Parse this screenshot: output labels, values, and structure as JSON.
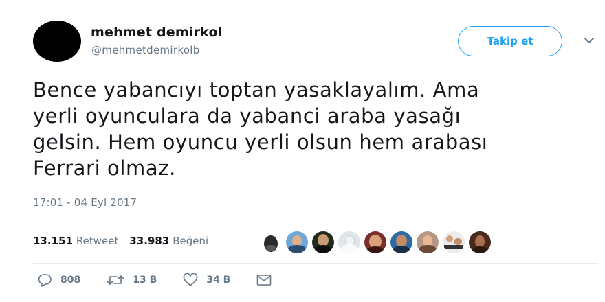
{
  "user": {
    "name": "mehmet demirkol",
    "handle": "@mehmetdemirkolb",
    "follow_label": "Takip et"
  },
  "tweet": {
    "lines": [
      "Bence yabancıyı toptan yasaklayalım. Ama",
      "yerli oyunculara da yabanci araba yasağı",
      "gelsin. Hem oyuncu yerli olsun hem arabası",
      "Ferrari olmaz."
    ],
    "timestamp": "17:01 - 04 Eyl 2017"
  },
  "stats": {
    "retweets_count": "13.151",
    "retweets_label": "Retweet",
    "likes_count": "33.983",
    "likes_label": "Beğeni"
  },
  "actions": {
    "replies": "808",
    "retweets": "13 B",
    "likes": "34 B"
  },
  "icons": [
    "chevron-down-icon",
    "reply-icon",
    "retweet-icon",
    "heart-icon",
    "mail-icon"
  ],
  "colors": {
    "accent": "#1da1f2",
    "muted": "#657786",
    "text": "#14171a",
    "divider": "#e6ecf0"
  }
}
